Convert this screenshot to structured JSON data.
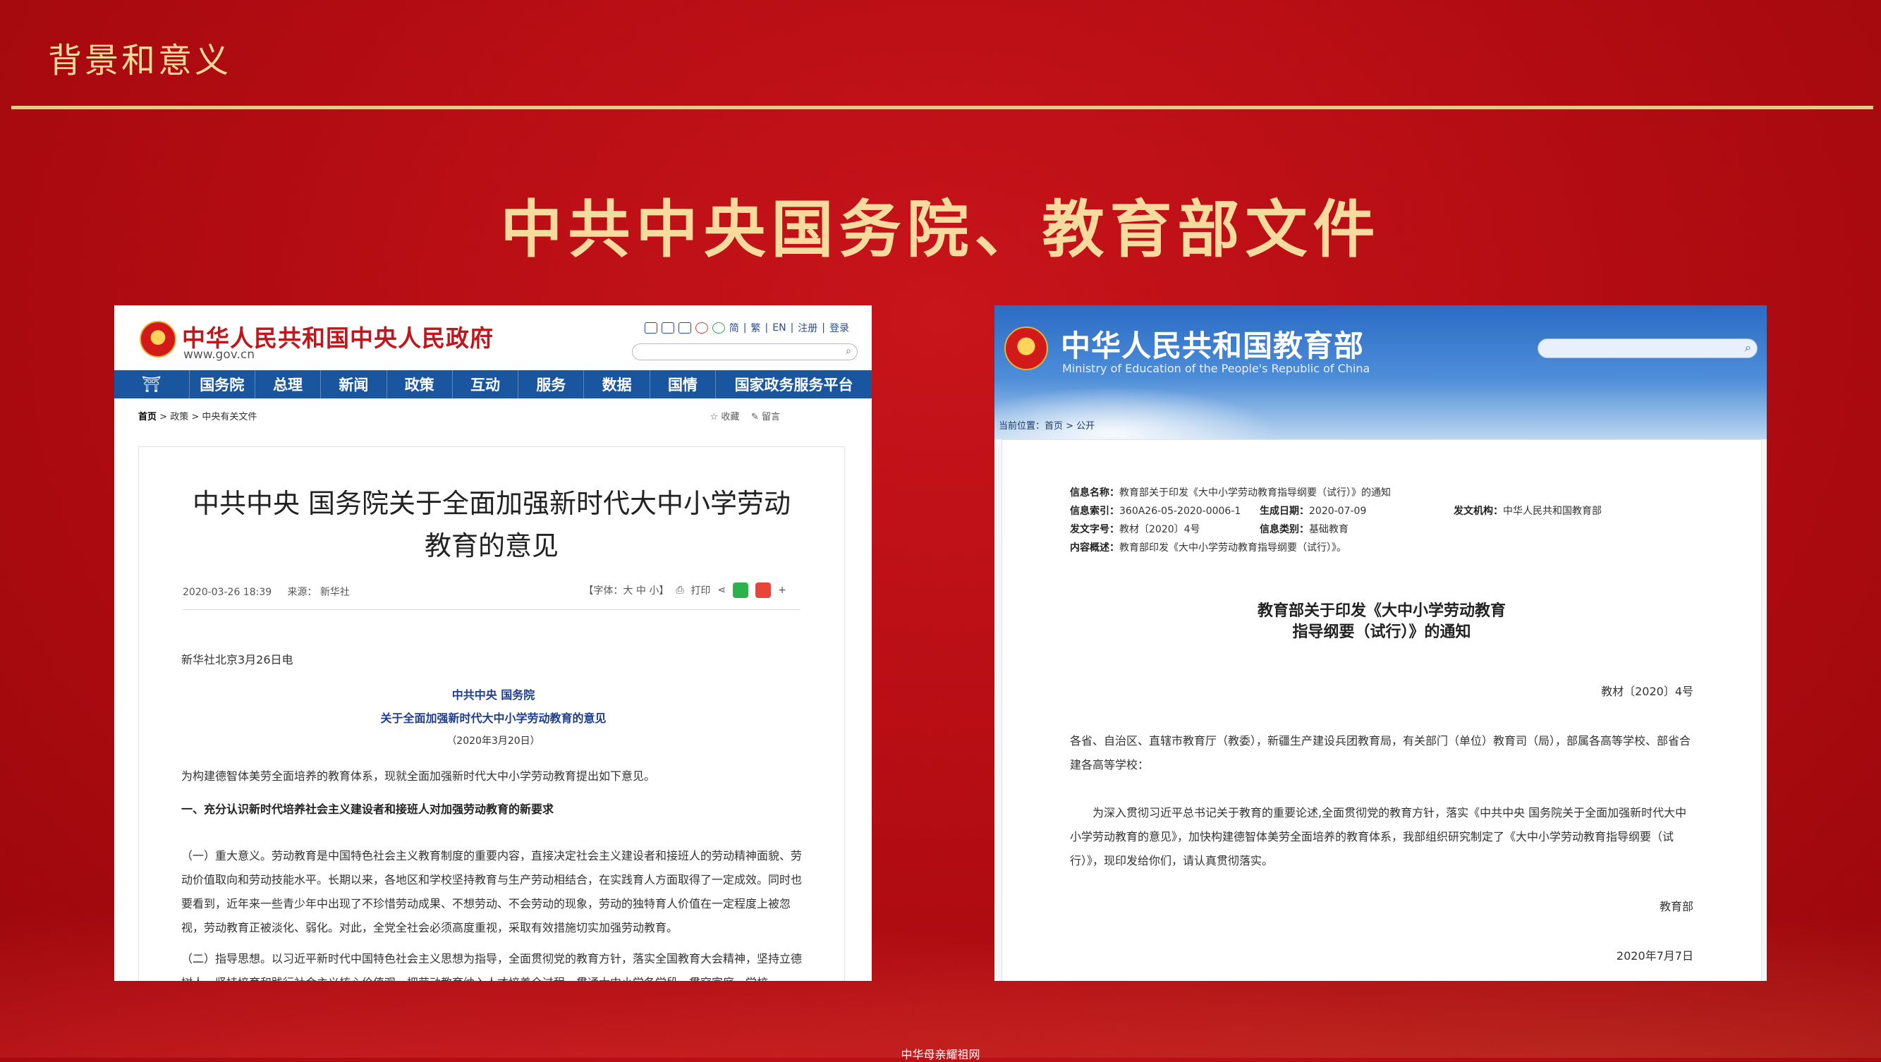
{
  "slide": {
    "section_title": "背景和意义",
    "main_title": "中共中央国务院、教育部文件",
    "footer": "中华母亲耀祖网"
  },
  "gov": {
    "site_name": "中华人民共和国中央人民政府",
    "site_url": "www.gov.cn",
    "toplinks": [
      "简",
      "繁",
      "EN",
      "注册",
      "登录"
    ],
    "nav": [
      "国务院",
      "总理",
      "新闻",
      "政策",
      "互动",
      "服务",
      "数据",
      "国情",
      "国家政务服务平台"
    ],
    "breadcrumb": [
      "首页",
      "政策",
      "中央有关文件"
    ],
    "actions": [
      "收藏",
      "留言"
    ],
    "article_title": "中共中央 国务院关于全面加强新时代大中小学劳动教育的意见",
    "date": "2020-03-26 18:39",
    "source": "来源： 新华社",
    "font_size_label": "【字体：大 中 小】",
    "print_label": "打印",
    "dateline": "新华社北京3月26日电",
    "issuer": "中共中央 国务院",
    "doc_subtitle": "关于全面加强新时代大中小学劳动教育的意见",
    "doc_date": "（2020年3月20日）",
    "intro": "为构建德智体美劳全面培养的教育体系，现就全面加强新时代大中小学劳动教育提出如下意见。",
    "heading1": "一、充分认识新时代培养社会主义建设者和接班人对加强劳动教育的新要求",
    "para1": "（一）重大意义。劳动教育是中国特色社会主义教育制度的重要内容，直接决定社会主义建设者和接班人的劳动精神面貌、劳动价值取向和劳动技能水平。长期以来，各地区和学校坚持教育与生产劳动相结合，在实践育人方面取得了一定成效。同时也要看到，近年来一些青少年中出现了不珍惜劳动成果、不想劳动、不会劳动的现象，劳动的独特育人价值在一定程度上被忽视，劳动教育正被淡化、弱化。对此，全党全社会必须高度重视，采取有效措施切实加强劳动教育。",
    "para2": "（二）指导思想。以习近平新时代中国特色社会主义思想为指导，全面贯彻党的教育方针，落实全国教育大会精神，坚持立德树人，坚持培育和践行社会主义核心价值观，把劳动教育纳入人才培养全过程，贯通大中小学各学段，贯穿家庭、学校"
  },
  "moe": {
    "site_name": "中华人民共和国教育部",
    "site_name_en": "Ministry of Education of the People's Republic of China",
    "breadcrumb": "当前位置：首页 > 公开",
    "info_rows": [
      {
        "label": "信息名称：",
        "value": "教育部关于印发《大中小学劳动教育指导纲要（试行）》的通知"
      },
      {
        "label": "信息索引：",
        "value": "360A26-05-2020-0006-1"
      },
      {
        "label": "生成日期：",
        "value": "2020-07-09"
      },
      {
        "label": "发文机构：",
        "value": "中华人民共和国教育部"
      },
      {
        "label": "发文字号：",
        "value": "教材〔2020〕4号"
      },
      {
        "label": "信息类别：",
        "value": "基础教育"
      },
      {
        "label": "内容概述：",
        "value": "教育部印发《大中小学劳动教育指导纲要（试行）》。"
      }
    ],
    "doc_title_1": "教育部关于印发《大中小学劳动教育",
    "doc_title_2": "指导纲要（试行）》的通知",
    "doc_number": "教材〔2020〕4号",
    "addressee": "各省、自治区、直辖市教育厅（教委），新疆生产建设兵团教育局，有关部门（单位）教育司（局），部属各高等学校、部省合建各高等学校：",
    "body": "为深入贯彻习近平总书记关于教育的重要论述,全面贯彻党的教育方针，落实《中共中央 国务院关于全面加强新时代大中小学劳动教育的意见》，加快构建德智体美劳全面培养的教育体系，我部组织研究制定了《大中小学劳动教育指导纲要（试行）》，现印发给你们，请认真贯彻落实。",
    "signature": "教育部",
    "sign_date": "2020年7月7日"
  }
}
